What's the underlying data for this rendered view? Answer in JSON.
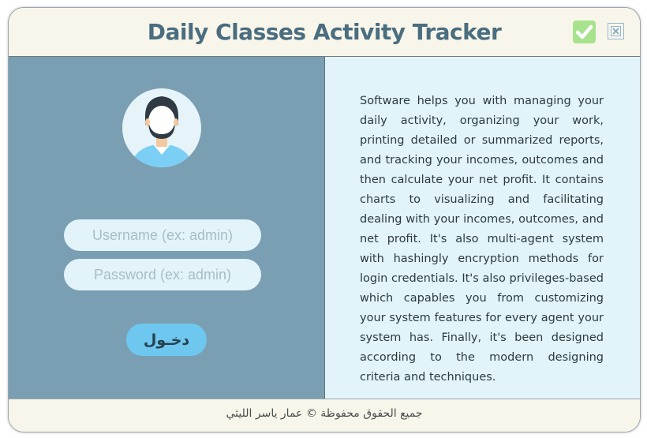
{
  "window": {
    "title": "Daily Classes Activity Tracker"
  },
  "titlebar": {
    "ok_icon": "checkmark-icon",
    "close_icon": "close-icon",
    "ok_color": "#a6e38c"
  },
  "login": {
    "avatar_icon": "user-avatar-icon",
    "username_placeholder": "Username (ex: admin)",
    "password_placeholder": "Password (ex: admin)",
    "login_label": "دخـول",
    "panel_color": "#7a9fb2",
    "button_color": "#6dc7ef"
  },
  "info": {
    "description": "Software helps you with managing your daily activity, organizing your work, printing detailed or summarized reports, and tracking your incomes, outcomes and then calculate your net profit. It contains charts to visualizing and facilitating dealing with your incomes, outcomes, and net profit. It's also multi-agent system with hashingly encryption methods for login credentials. It's also privileges-based which capables you from customizing your system features for every agent your system has. Finally, it's been designed according to the modern designing criteria and techniques.",
    "panel_color": "#e3f3fa"
  },
  "footer": {
    "copyright": "جميع الحقوق محفوظة © عمار ياسر الليثي"
  }
}
